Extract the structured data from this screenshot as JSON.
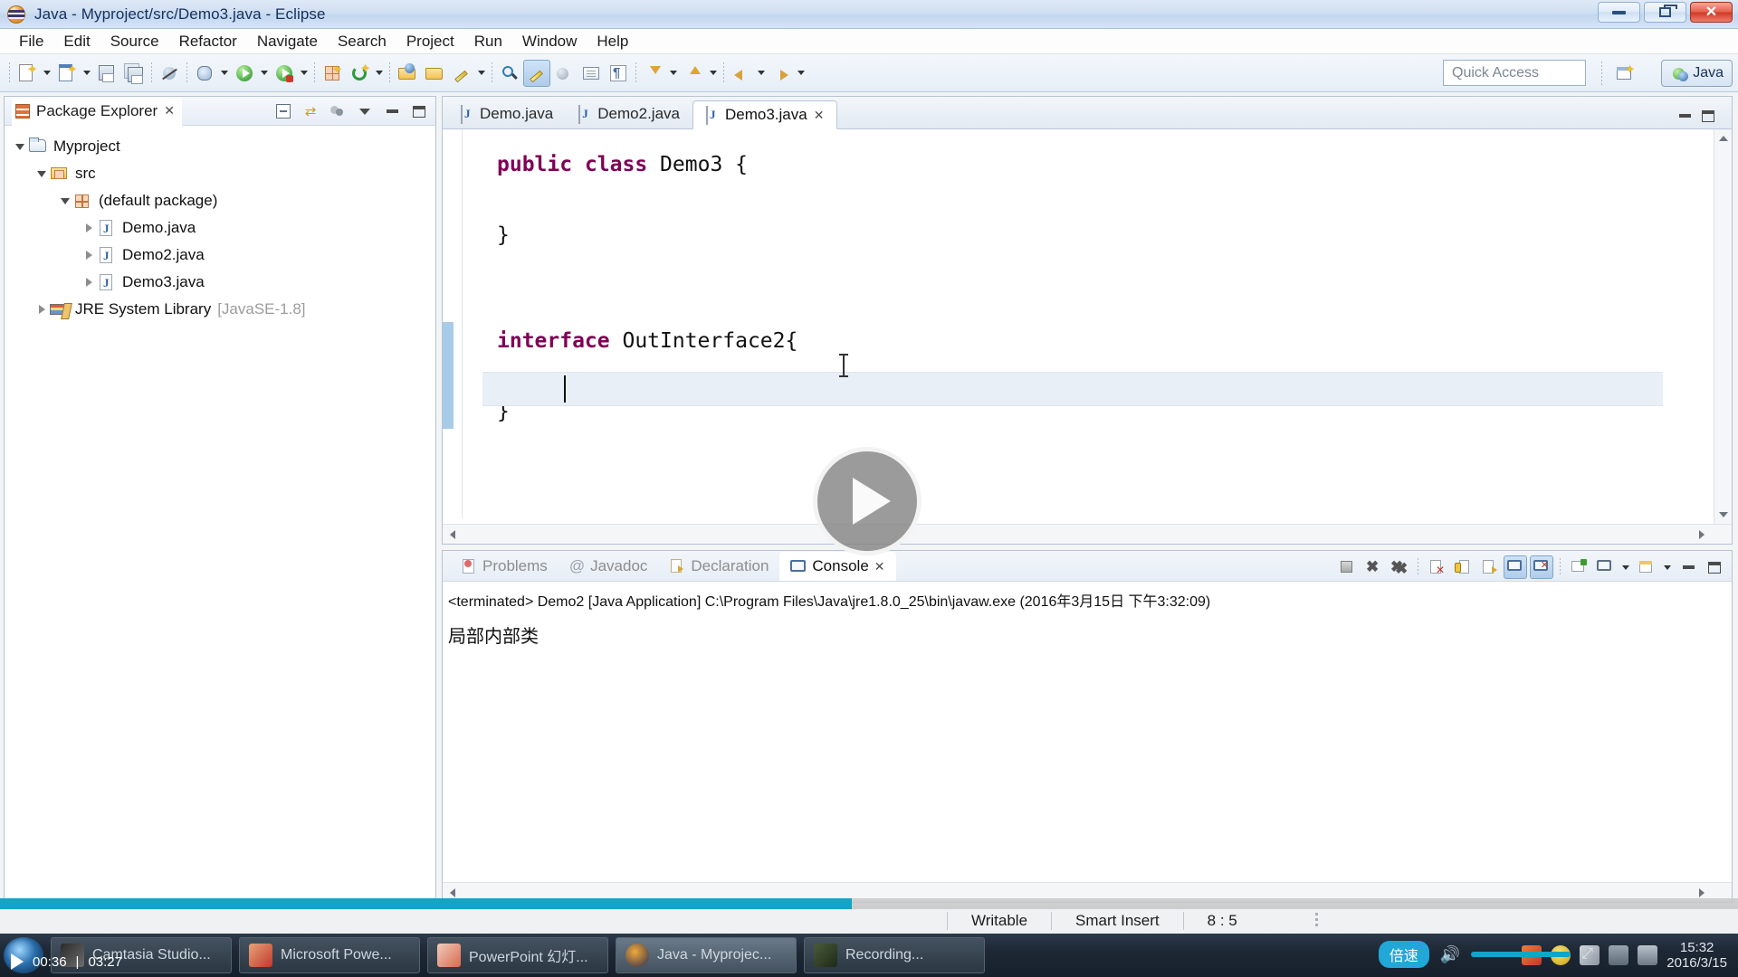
{
  "window": {
    "title": "Java - Myproject/src/Demo3.java - Eclipse",
    "app_icon": "eclipse-icon",
    "minimize_label": "Minimize",
    "restore_label": "Restore",
    "close_label": "Close",
    "close_glyph": "✕"
  },
  "menubar": {
    "items": [
      "File",
      "Edit",
      "Source",
      "Refactor",
      "Navigate",
      "Search",
      "Project",
      "Run",
      "Window",
      "Help"
    ]
  },
  "toolbar": {
    "quick_access_placeholder": "Quick Access",
    "perspective_open_label": "Open Perspective",
    "perspective_current": "Java",
    "buttons": [
      {
        "name": "new-wizard",
        "icon": "new-file-icon"
      },
      {
        "name": "new-java-class",
        "icon": "new-class-icon"
      },
      {
        "name": "save",
        "icon": "save-icon"
      },
      {
        "name": "save-all",
        "icon": "save-all-icon"
      },
      {
        "name": "toggle-breakpoint",
        "icon": "breakpoint-off-icon"
      },
      {
        "name": "debug",
        "icon": "debug-icon"
      },
      {
        "name": "run",
        "icon": "run-icon"
      },
      {
        "name": "run-external-tools",
        "icon": "external-tools-icon"
      },
      {
        "name": "new-package",
        "icon": "package-icon"
      },
      {
        "name": "refresh",
        "icon": "refresh-icon"
      },
      {
        "name": "open-type",
        "icon": "open-type-icon"
      },
      {
        "name": "open-task",
        "icon": "open-task-icon"
      },
      {
        "name": "edit-marker",
        "icon": "marker-icon"
      },
      {
        "name": "search",
        "icon": "search-icon"
      },
      {
        "name": "highlight",
        "icon": "highlight-icon"
      },
      {
        "name": "skip-breakpoints",
        "icon": "skip-breakpoints-icon"
      },
      {
        "name": "show-whitespace",
        "icon": "whitespace-icon"
      },
      {
        "name": "toggle-mark-occurrences",
        "icon": "pilcrow-icon"
      },
      {
        "name": "next-annotation",
        "icon": "next-annotation-icon"
      },
      {
        "name": "previous-annotation",
        "icon": "previous-annotation-icon"
      },
      {
        "name": "back",
        "icon": "back-arrow-icon"
      },
      {
        "name": "forward",
        "icon": "forward-arrow-icon"
      }
    ]
  },
  "package_explorer": {
    "title": "Package Explorer",
    "close_glyph": "✕",
    "tools": [
      {
        "name": "collapse-all-button",
        "icon": "collapse-all-icon"
      },
      {
        "name": "link-with-editor-button",
        "icon": "link-editor-icon"
      },
      {
        "name": "focus-on-active-task-button",
        "icon": "focus-task-icon"
      },
      {
        "name": "view-menu-button",
        "icon": "view-menu-icon"
      },
      {
        "name": "minimize-view-button",
        "icon": "minimize-icon"
      },
      {
        "name": "maximize-view-button",
        "icon": "maximize-icon"
      }
    ],
    "tree": [
      {
        "label": "Myproject",
        "icon": "java-project-icon",
        "depth": 0,
        "state": "expanded",
        "suffix": ""
      },
      {
        "label": "src",
        "icon": "source-folder-icon",
        "depth": 1,
        "state": "expanded",
        "suffix": ""
      },
      {
        "label": "(default package)",
        "icon": "package-icon",
        "depth": 2,
        "state": "expanded",
        "suffix": ""
      },
      {
        "label": "Demo.java",
        "icon": "java-file-icon",
        "depth": 3,
        "state": "collapsed",
        "suffix": ""
      },
      {
        "label": "Demo2.java",
        "icon": "java-file-icon",
        "depth": 3,
        "state": "collapsed",
        "suffix": ""
      },
      {
        "label": "Demo3.java",
        "icon": "java-file-icon",
        "depth": 3,
        "state": "collapsed",
        "suffix": ""
      },
      {
        "label": "JRE System Library",
        "icon": "jre-library-icon",
        "depth": 1,
        "state": "collapsed",
        "suffix": "[JavaSE-1.8]"
      }
    ]
  },
  "editor": {
    "tabs": [
      {
        "label": "Demo.java",
        "icon": "java-file-icon",
        "active": false,
        "closable": false
      },
      {
        "label": "Demo2.java",
        "icon": "java-file-icon",
        "active": false,
        "closable": false
      },
      {
        "label": "Demo3.java",
        "icon": "java-file-icon",
        "active": true,
        "closable": true
      }
    ],
    "tab_close_glyph": "✕",
    "minimize_label": "Minimize",
    "maximize_label": "Maximize",
    "code_lines": [
      {
        "text": "public class Demo3 {",
        "tokens": [
          {
            "t": "public",
            "k": true
          },
          {
            "t": " ",
            "k": false
          },
          {
            "t": "class",
            "k": true
          },
          {
            "t": " Demo3 {",
            "k": false
          }
        ]
      },
      {
        "text": "",
        "tokens": []
      },
      {
        "text": "}",
        "tokens": [
          {
            "t": "}",
            "k": false
          }
        ]
      },
      {
        "text": "",
        "tokens": []
      },
      {
        "text": "",
        "tokens": []
      },
      {
        "text": "interface OutInterface2{",
        "tokens": [
          {
            "t": "interface",
            "k": true
          },
          {
            "t": " OutInterface2{",
            "k": false
          }
        ]
      },
      {
        "text": "    ",
        "tokens": []
      },
      {
        "text": "}",
        "tokens": [
          {
            "t": "}",
            "k": false
          }
        ]
      }
    ]
  },
  "console": {
    "tabs": [
      {
        "label": "Problems",
        "icon": "problems-icon",
        "active": false
      },
      {
        "label": "Javadoc",
        "icon": "javadoc-icon",
        "active": false
      },
      {
        "label": "Declaration",
        "icon": "declaration-icon",
        "active": false
      },
      {
        "label": "Console",
        "icon": "console-icon",
        "active": true
      }
    ],
    "tab_close_glyph": "✕",
    "launch_line": "<terminated> Demo2 [Java Application] C:\\Program Files\\Java\\jre1.8.0_25\\bin\\javaw.exe (2016年3月15日 下午3:32:09)",
    "output": "局部内部类",
    "tools": [
      {
        "name": "terminate-button",
        "icon": "terminate-icon"
      },
      {
        "name": "remove-launch-button",
        "icon": "remove-launch-icon"
      },
      {
        "name": "remove-all-terminated-button",
        "icon": "remove-all-icon"
      },
      {
        "name": "clear-console-button",
        "icon": "clear-console-icon"
      },
      {
        "name": "scroll-lock-button",
        "icon": "scroll-lock-icon"
      },
      {
        "name": "word-wrap-button",
        "icon": "word-wrap-icon"
      },
      {
        "name": "show-console-on-output-button",
        "icon": "show-on-output-icon",
        "pressed": true
      },
      {
        "name": "show-console-on-error-button",
        "icon": "show-on-error-icon",
        "pressed": true
      },
      {
        "name": "pin-console-button",
        "icon": "pin-console-icon"
      },
      {
        "name": "display-selected-console-button",
        "icon": "display-console-icon"
      },
      {
        "name": "open-console-button",
        "icon": "open-console-icon"
      },
      {
        "name": "minimize-view-button",
        "icon": "minimize-icon"
      },
      {
        "name": "maximize-view-button",
        "icon": "maximize-icon"
      }
    ]
  },
  "statusbar": {
    "writable": "Writable",
    "insert_mode": "Smart Insert",
    "cursor_position": "8 : 5"
  },
  "taskbar": {
    "start_label": "Start",
    "tasks": [
      {
        "label": "Camtasia Studio...",
        "icon": "camtasia-icon",
        "active": false
      },
      {
        "label": "Microsoft Powe...",
        "icon": "powerpoint-icon",
        "active": false
      },
      {
        "label": "PowerPoint 幻灯...",
        "icon": "powerpoint-show-icon",
        "active": false
      },
      {
        "label": "Java - Myprojec...",
        "icon": "eclipse-icon",
        "active": true
      },
      {
        "label": "Recording...",
        "icon": "recording-icon",
        "active": false
      }
    ],
    "tray_icons": [
      "sogou-icon",
      "plus-icon",
      "antivirus-icon",
      "network-icon",
      "signal-icon"
    ],
    "clock_time": "15:32",
    "clock_date": "2016/3/15"
  },
  "video_player": {
    "play_button_label": "Play",
    "elapsed": "00:36",
    "duration": "03:27",
    "separator": "|",
    "speed_label": "倍速",
    "progress_percent": 49,
    "volume_percent": 100,
    "expand_label": "Expand"
  },
  "colors": {
    "keyword": "#7f0055",
    "accent": "#11a5c6",
    "titlebar": "#cfdff2",
    "selection": "#e8eff7",
    "change_bar": "#a8cbe8"
  }
}
